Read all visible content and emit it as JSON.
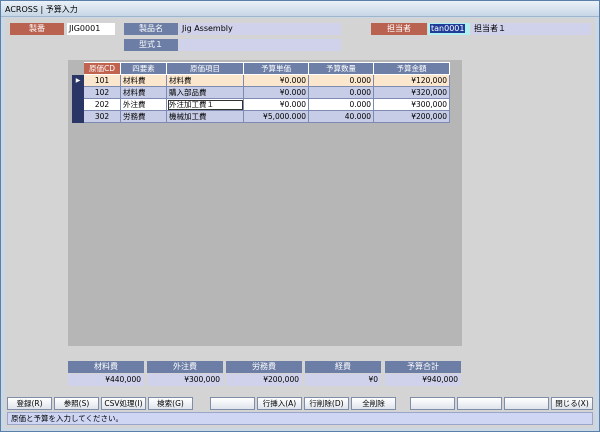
{
  "window": {
    "title": "ACROSS | 予算入力"
  },
  "header": {
    "seiban_label": "製番",
    "seiban_value": "JIG0001",
    "product_label": "製品名",
    "product_value": "Jig Assembly",
    "model_label": "型式１",
    "model_value": "",
    "person_label": "担当者",
    "person_code": "tan0001",
    "person_name": "担当者１"
  },
  "grid": {
    "columns": [
      "原価CD",
      "四要素",
      "原価項目",
      "予算単価",
      "予算数量",
      "予算金額"
    ],
    "current_row_indicator": "▶",
    "rows": [
      {
        "cd": "101",
        "element": "材料費",
        "item": "材料費",
        "unit_price": "¥0.000",
        "qty": "0.000",
        "amount": "¥120,000"
      },
      {
        "cd": "102",
        "element": "材料費",
        "item": "購入部品費",
        "unit_price": "¥0.000",
        "qty": "0.000",
        "amount": "¥320,000"
      },
      {
        "cd": "202",
        "element": "外注費",
        "item": "外注加工費１",
        "unit_price": "¥0.000",
        "qty": "0.000",
        "amount": "¥300,000"
      },
      {
        "cd": "302",
        "element": "労務費",
        "item": "機械加工費",
        "unit_price": "¥5,000.000",
        "qty": "40.000",
        "amount": "¥200,000"
      }
    ]
  },
  "summary": {
    "material_label": "材料費",
    "material_value": "¥440,000",
    "outsource_label": "外注費",
    "outsource_value": "¥300,000",
    "labor_label": "労務費",
    "labor_value": "¥200,000",
    "expense_label": "経費",
    "expense_value": "¥0",
    "total_label": "予算合計",
    "total_value": "¥940,000"
  },
  "buttons": {
    "register": "登録(R)",
    "reference": "参照(S)",
    "csv": "CSV処理(I)",
    "search": "検索(G)",
    "blank1": "",
    "insert_row": "行挿入(A)",
    "delete_row": "行削除(D)",
    "delete_all": "全削除",
    "blank2": "",
    "blank3": "",
    "blank4": "",
    "close": "閉じる(X)"
  },
  "status": {
    "message": "原価と予算を入力してください。"
  }
}
